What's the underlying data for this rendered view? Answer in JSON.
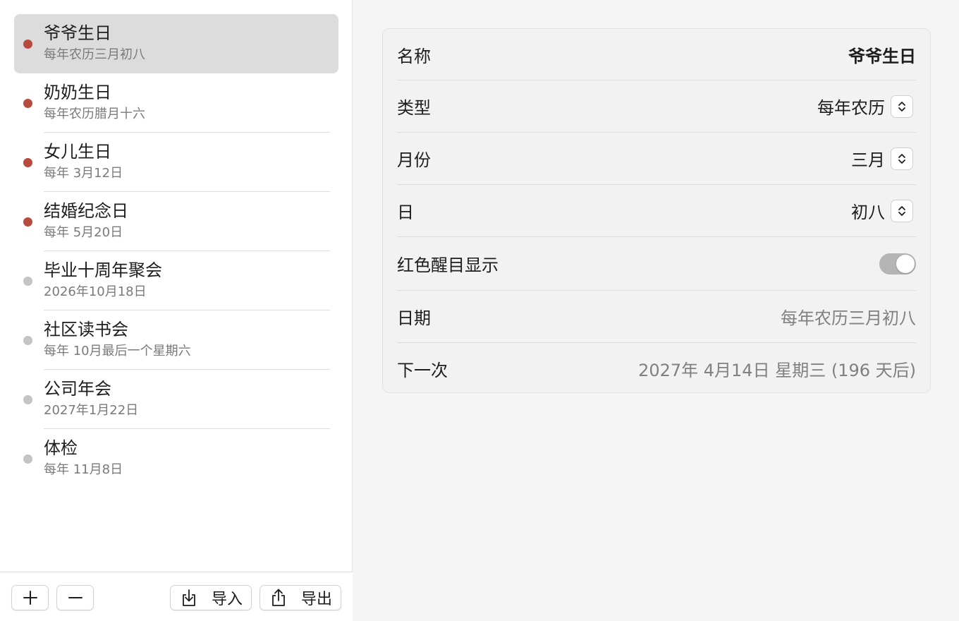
{
  "colors": {
    "dot_red": "#b84a3e",
    "dot_gray": "#c4c4c4",
    "selected_bg": "#dcdcdc"
  },
  "sidebar": {
    "items": [
      {
        "title": "爷爷生日",
        "subtitle": "每年农历三月初八",
        "dot": "red",
        "selected": true
      },
      {
        "title": "奶奶生日",
        "subtitle": "每年农历腊月十六",
        "dot": "red",
        "selected": false
      },
      {
        "title": "女儿生日",
        "subtitle": "每年 3月12日",
        "dot": "red",
        "selected": false
      },
      {
        "title": "结婚纪念日",
        "subtitle": "每年 5月20日",
        "dot": "red",
        "selected": false
      },
      {
        "title": "毕业十周年聚会",
        "subtitle": "2026年10月18日",
        "dot": "gray",
        "selected": false
      },
      {
        "title": "社区读书会",
        "subtitle": "每年 10月最后一个星期六",
        "dot": "gray",
        "selected": false
      },
      {
        "title": "公司年会",
        "subtitle": "2027年1月22日",
        "dot": "gray",
        "selected": false
      },
      {
        "title": "体检",
        "subtitle": "每年 11月8日",
        "dot": "gray",
        "selected": false
      }
    ]
  },
  "toolbar": {
    "add_label": "+",
    "remove_label": "−",
    "import_label": "导入",
    "export_label": "导出",
    "import_icon": "tray-download-icon",
    "export_icon": "share-icon"
  },
  "detail": {
    "name": {
      "label": "名称",
      "value": "爷爷生日"
    },
    "type": {
      "label": "类型",
      "value": "每年农历"
    },
    "month": {
      "label": "月份",
      "value": "三月"
    },
    "day": {
      "label": "日",
      "value": "初八"
    },
    "highlight": {
      "label": "红色醒目显示",
      "on": true
    },
    "date": {
      "label": "日期",
      "value": "每年农历三月初八"
    },
    "next": {
      "label": "下一次",
      "value": "2027年 4月14日 星期三 (196 天后)"
    }
  }
}
